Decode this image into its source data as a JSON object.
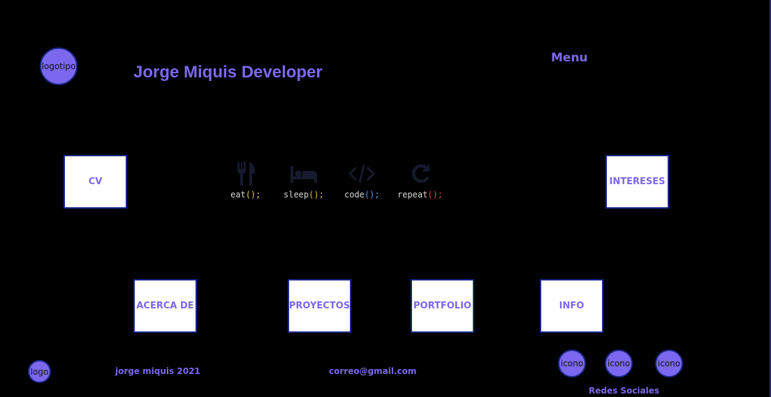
{
  "header": {
    "logo_label": "logotipo",
    "title": "Jorge Miquis Developer",
    "menu_label": "Menu"
  },
  "nav_boxes": {
    "cv": "CV",
    "intereses": "INTERESES",
    "acerca": "ACERCA DE",
    "proyectos": "PROYECTOS",
    "portfolio": "PORTFOLIO",
    "info": "INFO"
  },
  "motto": [
    {
      "icon": "fork-knife-icon",
      "word": "eat",
      "paren": "();"
    },
    {
      "icon": "bed-icon",
      "word": "sleep",
      "paren": "();"
    },
    {
      "icon": "code-icon",
      "word": "code",
      "paren": "();"
    },
    {
      "icon": "redo-icon",
      "word": "repeat",
      "paren": "();"
    }
  ],
  "footer": {
    "logo_label": "logo",
    "copyright": "jorge miquis 2021",
    "email": "correo@gmail.com",
    "social_icons": [
      "icono",
      "icono",
      "icono"
    ],
    "social_label": "Redes Sociales"
  },
  "colors": {
    "accent": "#7b68ee",
    "background": "#000000",
    "border": "#1b2a8a"
  }
}
